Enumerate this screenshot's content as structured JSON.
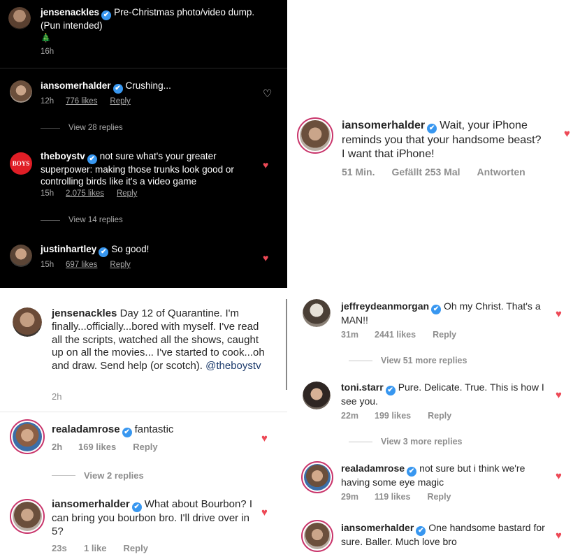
{
  "panel_a": {
    "post": {
      "username": "jensenackles",
      "caption": "Pre-Christmas photo/video dump. (Pun intended)",
      "emoji": "🎄",
      "time": "16h"
    },
    "comments": [
      {
        "username": "iansomerhalder",
        "text": "Crushing...",
        "time": "12h",
        "likes": "776 likes",
        "reply": "Reply"
      },
      {
        "username": "theboystv",
        "text": "not sure what's your greater superpower: making those trunks look good or controlling birds like it's a video game",
        "time": "15h",
        "likes": "2.075 likes",
        "reply": "Reply"
      },
      {
        "username": "justinhartley",
        "text": "So good!",
        "time": "15h",
        "likes": "697 likes",
        "reply": "Reply"
      }
    ],
    "view_replies": [
      "View 28 replies",
      "View 14 replies"
    ],
    "theboys_logo": "BOYS"
  },
  "panel_b": {
    "comment": {
      "username": "iansomerhalder",
      "text": "Wait, your iPhone reminds you that your handsome beast? I want that iPhone!",
      "time": "51 Min.",
      "likes": "Gefällt 253 Mal",
      "reply": "Antworten"
    }
  },
  "panel_c": {
    "post": {
      "username": "jensenackles",
      "caption": "Day 12 of Quarantine.  I'm finally...officially...bored with myself. I've read all the scripts, watched all the shows, caught up on all the movies... I've started to cook...oh and draw. Send help (or scotch).",
      "mention": "@theboystv",
      "time": "2h"
    },
    "comments": [
      {
        "username": "realadamrose",
        "text": "fantastic",
        "time": "2h",
        "likes": "169 likes",
        "reply": "Reply"
      },
      {
        "username": "iansomerhalder",
        "text": "What about Bourbon? I can bring  you bourbon bro. I'll drive over in 5?",
        "time": "23s",
        "likes": "1 like",
        "reply": "Reply"
      }
    ],
    "view_replies": "View 2 replies"
  },
  "panel_d": {
    "comments": [
      {
        "username": "jeffreydeanmorgan",
        "text": "Oh my Christ. That's a MAN!!",
        "time": "31m",
        "likes": "2441 likes",
        "reply": "Reply"
      },
      {
        "username": "toni.starr",
        "text": "Pure. Delicate. True. This is how I see you.",
        "time": "22m",
        "likes": "199 likes",
        "reply": "Reply"
      },
      {
        "username": "realadamrose",
        "text": "not sure but i think we're having some eye magic",
        "time": "29m",
        "likes": "119 likes",
        "reply": "Reply"
      },
      {
        "username": "iansomerhalder",
        "text": "One handsome bastard for sure. Baller. Much love bro"
      }
    ],
    "view_replies": [
      "View 51 more replies",
      "View 3 more replies"
    ]
  },
  "icons": {
    "verified": "✔",
    "heart": "♥",
    "heart_outline": "♡"
  },
  "colors": {
    "heart": "#ed4956",
    "verified": "#3897f0",
    "dark_bg": "#000000",
    "muted": "#8e8e8e",
    "link": "#1b3a6b"
  }
}
